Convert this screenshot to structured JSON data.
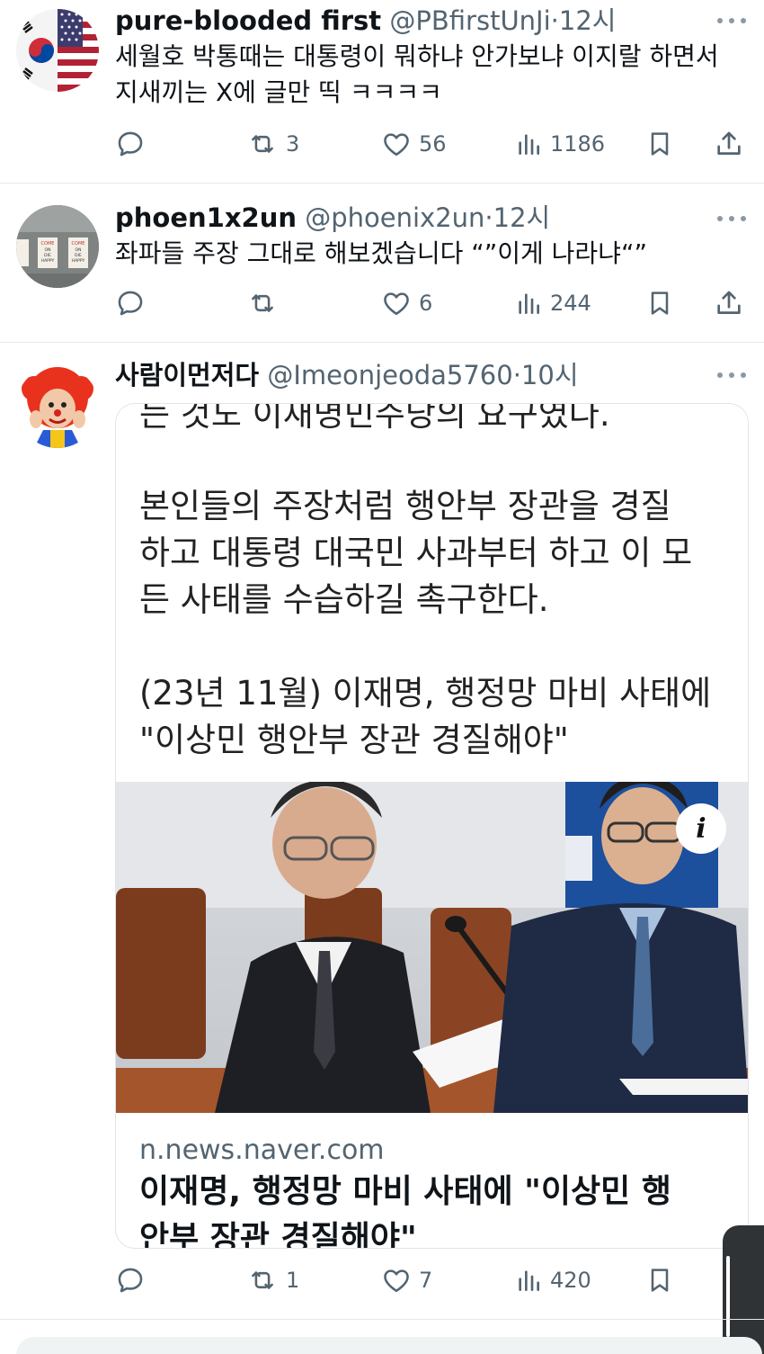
{
  "tweets": [
    {
      "name": "pure-blooded first",
      "handle": "@PBfirstUnJi",
      "sep": "·",
      "time": "12시",
      "text_lines": [
        "세월호 박통때는 대통령이 뭐하냐 안가보냐 이지랄 하면서",
        "지새끼는 X에 글만 띡 ㅋㅋㅋㅋ"
      ],
      "stats": {
        "retweets": "3",
        "likes": "56",
        "views": "1186"
      }
    },
    {
      "name": "phoen1x2un",
      "handle": "@phoenix2un",
      "sep": "·",
      "time": "12시",
      "text_lines": [
        "좌파들 주장 그대로 해보겠습니다 “”이게 나라냐“”"
      ],
      "avatar_signs": [
        "COME ON DIE HAPPY",
        "COME ON DIE HAPPY"
      ],
      "stats": {
        "retweets": "",
        "likes": "6",
        "views": "244"
      }
    },
    {
      "name": "사람이먼저다",
      "handle": "@Imeonjeoda5760",
      "sep": "·",
      "time": "10시",
      "text_lines": [],
      "stats": {
        "retweets": "1",
        "likes": "7",
        "views": "420"
      },
      "card": {
        "clipped_line": "는 것도 이재명민주당의 요구였다.",
        "para1": [
          "본인들의 주장처럼 행안부 장관을 경질",
          "하고 대통령 대국민 사과부터 하고 이 모",
          "든 사태를 수습하길 촉구한다."
        ],
        "para2": [
          "(23년 11월) 이재명, 행정망 마비 사태에",
          "\"이상민 행안부 장관 경질해야\""
        ],
        "info_badge": "i",
        "domain": "n.news.naver.com",
        "link_title": [
          "이재명, 행정망 마비 사태에 \"이상민 행",
          "안부 장관 경질해야\""
        ]
      }
    }
  ],
  "colors": {
    "text": "#0f1419",
    "muted": "#536471",
    "divider": "#e6e9eb",
    "handle_dark": "#2f3336"
  },
  "icons": [
    "reply-icon",
    "retweet-icon",
    "like-icon",
    "views-icon",
    "bookmark-icon",
    "share-icon",
    "more-icon",
    "info-icon"
  ]
}
